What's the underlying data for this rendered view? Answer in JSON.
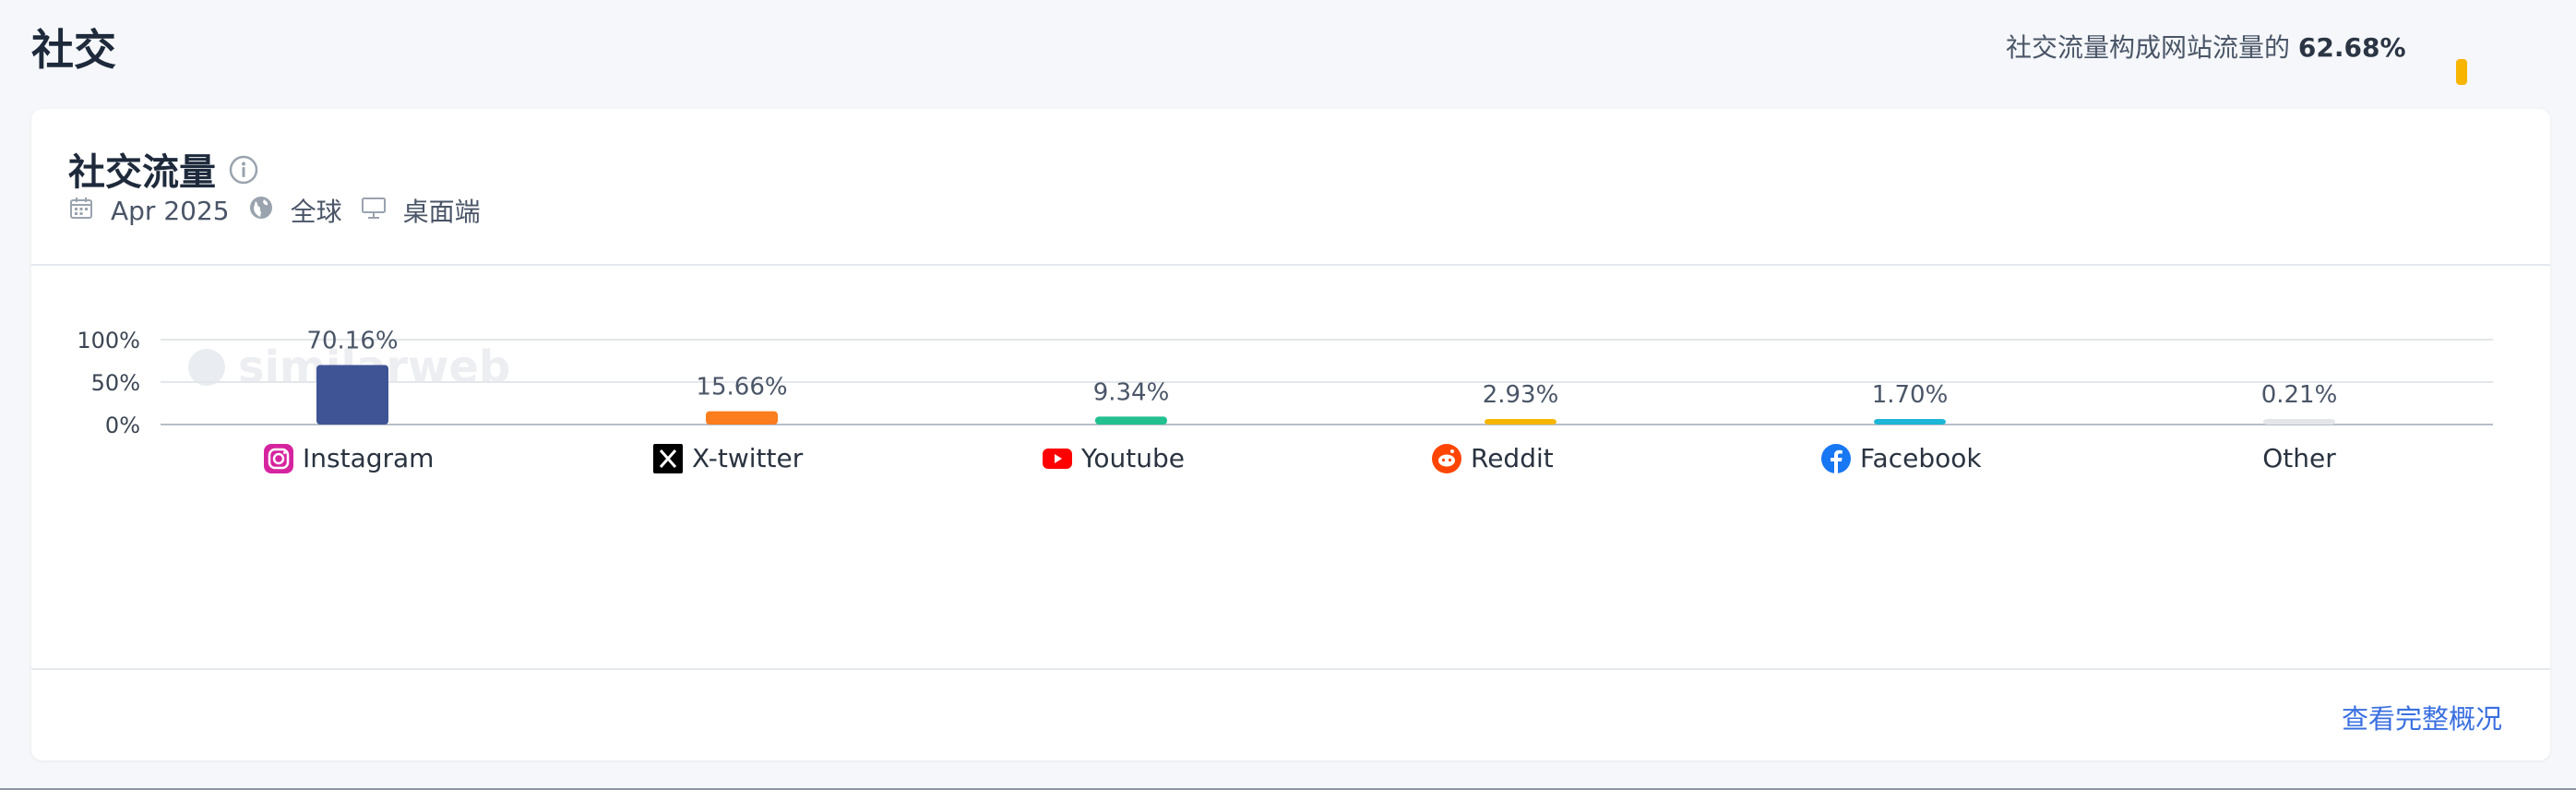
{
  "page": {
    "title": "社交",
    "summary_prefix": "社交流量构成网站流量的",
    "summary_value": "62.68%"
  },
  "card": {
    "title": "社交流量",
    "date": "Apr 2025",
    "region": "全球",
    "device": "桌面端",
    "footer_link": "查看完整概况",
    "watermark": "similarweb"
  },
  "colors": {
    "accent_link": "#3a6fe0",
    "summary_bar": "#f7b500"
  },
  "chart_data": {
    "type": "bar",
    "categories": [
      "Instagram",
      "X-twitter",
      "Youtube",
      "Reddit",
      "Facebook",
      "Other"
    ],
    "values": [
      70.16,
      15.66,
      9.34,
      2.93,
      1.7,
      0.21
    ],
    "value_labels": [
      "70.16%",
      "15.66%",
      "9.34%",
      "2.93%",
      "1.70%",
      "0.21%"
    ],
    "colors": [
      "#3f5495",
      "#fb7d1d",
      "#22c08f",
      "#f7b500",
      "#1db6d6",
      "#e3e5e8"
    ],
    "icons": [
      "instagram-icon",
      "x-twitter-icon",
      "youtube-icon",
      "reddit-icon",
      "facebook-icon",
      ""
    ],
    "yticks": [
      "100%",
      "50%",
      "0%"
    ],
    "ytick_values": [
      100,
      50,
      0
    ],
    "ylim": [
      0,
      100
    ],
    "title": "",
    "xlabel": "",
    "ylabel": "",
    "grid": true,
    "legend": "none"
  }
}
